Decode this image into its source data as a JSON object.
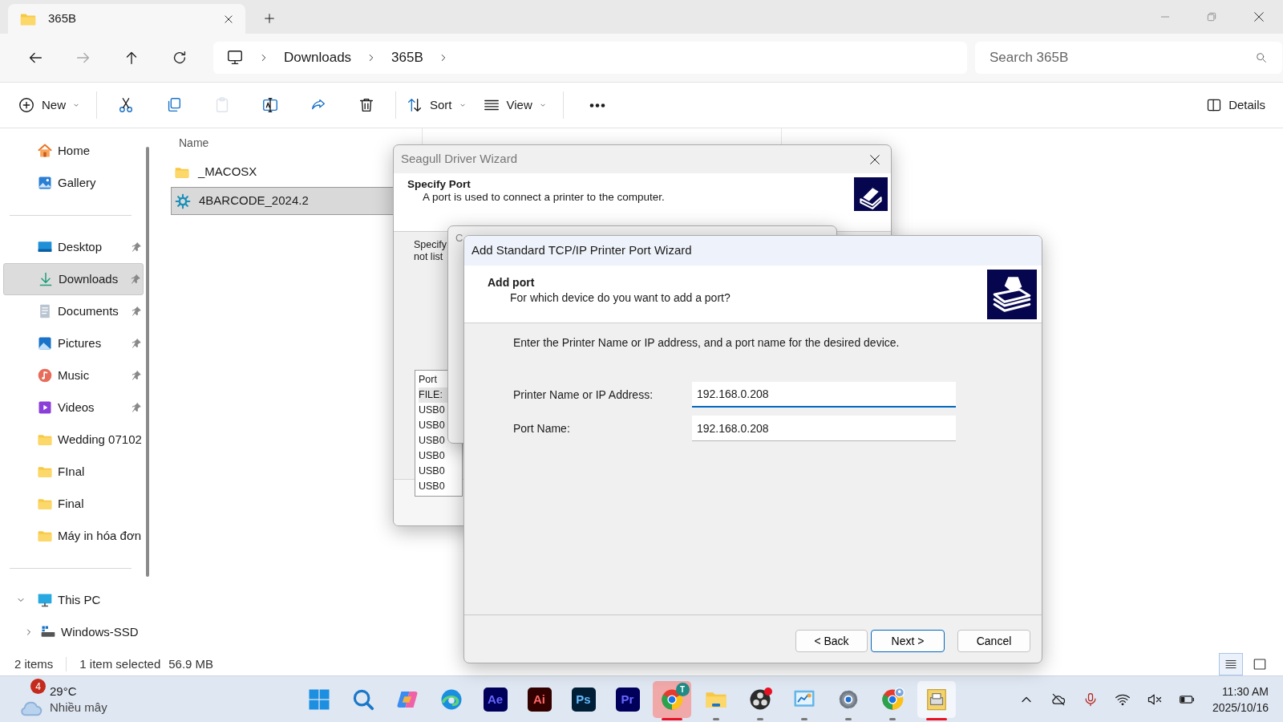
{
  "window": {
    "tab_title": "365B"
  },
  "nav": {
    "buttons": [
      {
        "kind": "back",
        "disabled": false
      },
      {
        "kind": "forward",
        "disabled": true
      },
      {
        "kind": "up",
        "disabled": false
      },
      {
        "kind": "refresh",
        "disabled": false
      }
    ],
    "breadcrumb": [
      "Downloads",
      "365B"
    ],
    "search": {
      "placeholder": "Search 365B"
    }
  },
  "toolbar": {
    "items": [
      {
        "kind": "new",
        "label": "New",
        "disabled": false
      },
      {
        "kind": "cut",
        "disabled": false
      },
      {
        "kind": "copy",
        "disabled": false
      },
      {
        "kind": "paste",
        "disabled": true
      },
      {
        "kind": "rename",
        "disabled": false
      },
      {
        "kind": "share",
        "disabled": false
      },
      {
        "kind": "delete",
        "disabled": false
      },
      {
        "kind": "sort",
        "label": "Sort",
        "disabled": false
      },
      {
        "kind": "view",
        "label": "View",
        "disabled": false
      },
      {
        "kind": "more",
        "disabled": false
      }
    ],
    "details": "Details"
  },
  "sidebar": {
    "sections": [
      [
        {
          "kind": "home",
          "label": "Home",
          "pinned": false,
          "selected": false
        },
        {
          "kind": "gallery",
          "label": "Gallery",
          "pinned": false,
          "selected": false
        }
      ],
      [
        {
          "kind": "desktop",
          "label": "Desktop",
          "pinned": true,
          "selected": false
        },
        {
          "kind": "downloads",
          "label": "Downloads",
          "pinned": true,
          "selected": true
        },
        {
          "kind": "documents",
          "label": "Documents",
          "pinned": true,
          "selected": false
        },
        {
          "kind": "pictures",
          "label": "Pictures",
          "pinned": true,
          "selected": false
        },
        {
          "kind": "music",
          "label": "Music",
          "pinned": true,
          "selected": false
        },
        {
          "kind": "videos",
          "label": "Videos",
          "pinned": true,
          "selected": false
        },
        {
          "kind": "folder",
          "label": "Wedding 07102",
          "selected": false
        },
        {
          "kind": "folder",
          "label": "FInal",
          "pinned": false,
          "selected": false
        },
        {
          "kind": "folder",
          "label": "Final",
          "pinned": false,
          "selected": false
        },
        {
          "kind": "folder",
          "label": "Máy in hóa đơn",
          "selected": false
        }
      ],
      [
        {
          "kind": "pc",
          "label": "This PC",
          "selected": false,
          "expanded": true,
          "children": [
            {
              "kind": "drive",
              "label": "Windows-SSD",
              "selected": false,
              "expanded": false
            }
          ]
        }
      ]
    ]
  },
  "files": {
    "columns": [
      "Name"
    ],
    "rows": [
      {
        "kind": "folder",
        "name": "_MACOSX",
        "selected": false
      },
      {
        "kind": "app",
        "name": "4BARCODE_2024.2",
        "selected": true
      }
    ]
  },
  "status_bar": {
    "count": "2 items",
    "selection": "1 item selected",
    "size": "56.9 MB",
    "views": [
      {
        "kind": "details",
        "selected": true
      },
      {
        "kind": "tiles",
        "selected": false
      }
    ]
  },
  "seagull_dialog": {
    "title": "Seagull Driver Wizard",
    "heading": "Specify Port",
    "subheading": "A port is used to connect a printer to the computer.",
    "body_text": [
      "Specify",
      "not list"
    ],
    "port_list": {
      "header": "Port",
      "rows": [
        {
          "text": "FILE:",
          "selected": true
        },
        {
          "text": "USB0",
          "selected": false
        },
        {
          "text": "USB0",
          "selected": false
        },
        {
          "text": "USB0",
          "selected": false
        },
        {
          "text": "USB0",
          "selected": false
        },
        {
          "text": "USB0",
          "selected": false
        },
        {
          "text": "USB0",
          "selected": false
        }
      ]
    }
  },
  "middle_dialog": {
    "title": "C"
  },
  "port_wizard": {
    "title": "Add Standard TCP/IP Printer Port Wizard",
    "heading": "Add port",
    "subheading": "For which device do you want to add a port?",
    "instruction": "Enter the Printer Name or IP address, and a port name for the desired device.",
    "fields": [
      {
        "label": "Printer Name or IP Address:",
        "value": "192.168.0.208",
        "focused": true
      },
      {
        "label": "Port Name:",
        "value": "192.168.0.208",
        "focused": false
      }
    ],
    "buttons": [
      {
        "label": "< Back",
        "default": false
      },
      {
        "label": "Next >",
        "default": true
      },
      {
        "label": "Cancel",
        "default": false
      }
    ]
  },
  "taskbar": {
    "weather": {
      "badge": "4",
      "temperature": "29°C",
      "condition": "Nhiều mây"
    },
    "apps": [
      {
        "kind": "start",
        "running": false,
        "attention": false,
        "selected": false
      },
      {
        "kind": "search",
        "running": false,
        "attention": false,
        "selected": false
      },
      {
        "kind": "copilot",
        "running": false,
        "attention": false,
        "selected": false
      },
      {
        "kind": "edge",
        "running": false,
        "attention": false,
        "selected": false
      },
      {
        "kind": "tile",
        "text": "Ae",
        "color": "#00005b",
        "running": false,
        "attention": false,
        "selected": false
      },
      {
        "kind": "tile",
        "text": "Ai",
        "color": "#330000",
        "running": false,
        "attention": false,
        "selected": false
      },
      {
        "kind": "tile",
        "text": "Ps",
        "color": "#001e36",
        "running": false,
        "attention": false,
        "selected": false
      },
      {
        "kind": "tile",
        "text": "Pr",
        "color": "#00005b",
        "running": false,
        "attention": false,
        "selected": false
      },
      {
        "kind": "chrome",
        "badge": "T",
        "running": true,
        "attention": true,
        "selected": false
      },
      {
        "kind": "explorer",
        "running": true,
        "attention": false,
        "selected": false
      },
      {
        "kind": "obs",
        "running": true,
        "attention": false,
        "selected": false
      },
      {
        "kind": "board",
        "running": true,
        "attention": false,
        "selected": false
      },
      {
        "kind": "settings",
        "running": true,
        "attention": false,
        "selected": false
      },
      {
        "kind": "chrome-profile",
        "running": true,
        "attention": false,
        "selected": false
      },
      {
        "kind": "printer",
        "running": true,
        "attention": true,
        "selected": true
      }
    ],
    "tray": [
      {
        "kind": "chevron"
      },
      {
        "kind": "cloud-off"
      },
      {
        "kind": "mic"
      },
      {
        "kind": "wifi"
      },
      {
        "kind": "volume-muted"
      },
      {
        "kind": "battery"
      }
    ],
    "clock": {
      "time": "11:30 AM",
      "date": "2025/10/16"
    }
  }
}
